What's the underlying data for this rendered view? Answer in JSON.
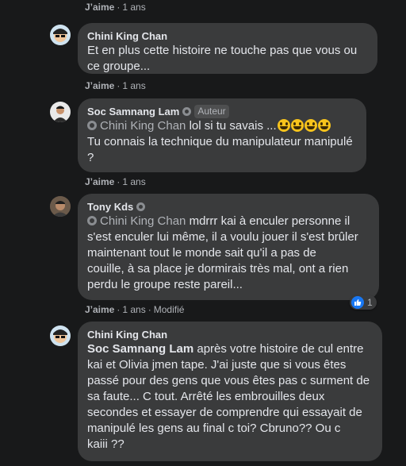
{
  "like_label": "J’aime",
  "separator": "·",
  "top_meta": {
    "time": "1 ans"
  },
  "comments": [
    {
      "author": "Chini King Chan",
      "lines": [
        "Et en plus cette histoire ne touche pas que vous ou",
        "ce groupe..."
      ],
      "time": "1 ans"
    },
    {
      "author": "Soc Samnang Lam",
      "role": "Auteur",
      "mention": "Chini King Chan",
      "first_line_text": " lol si tu savais ...",
      "emoji_count": 4,
      "lines": [
        "Tu connais la technique du manipulateur manipulé",
        "?"
      ],
      "time": "1 ans"
    },
    {
      "author": "Tony Kds",
      "mention": "Chini King Chan",
      "first_line_text": " mdrrr kai à enculer personne il",
      "lines": [
        "s'est enculer lui même, il a voulu jouer il s'est brûler",
        "maintenant tout le monde sait qu'il a pas de",
        "couille, à sa place je dormirais très mal, ont a rien",
        "perdu le groupe reste pareil..."
      ],
      "time": "1 ans",
      "edited": "Modifié",
      "reaction_count": "1"
    },
    {
      "author": "Chini King Chan",
      "mention": "Soc Samnang Lam",
      "first_line_text": " après votre histoire de cul entre",
      "lines": [
        "kai et Olivia jmen tape. J'ai juste que si vous êtes",
        "passé pour des gens que vous êtes pas c surment de",
        "sa faute... C tout. Arrêté les embrouilles deux",
        "secondes et essayer de comprendre qui essayait de",
        "manipulé les gens au final c toi? Cbruno?? Ou c",
        "kaiii ??"
      ]
    }
  ]
}
